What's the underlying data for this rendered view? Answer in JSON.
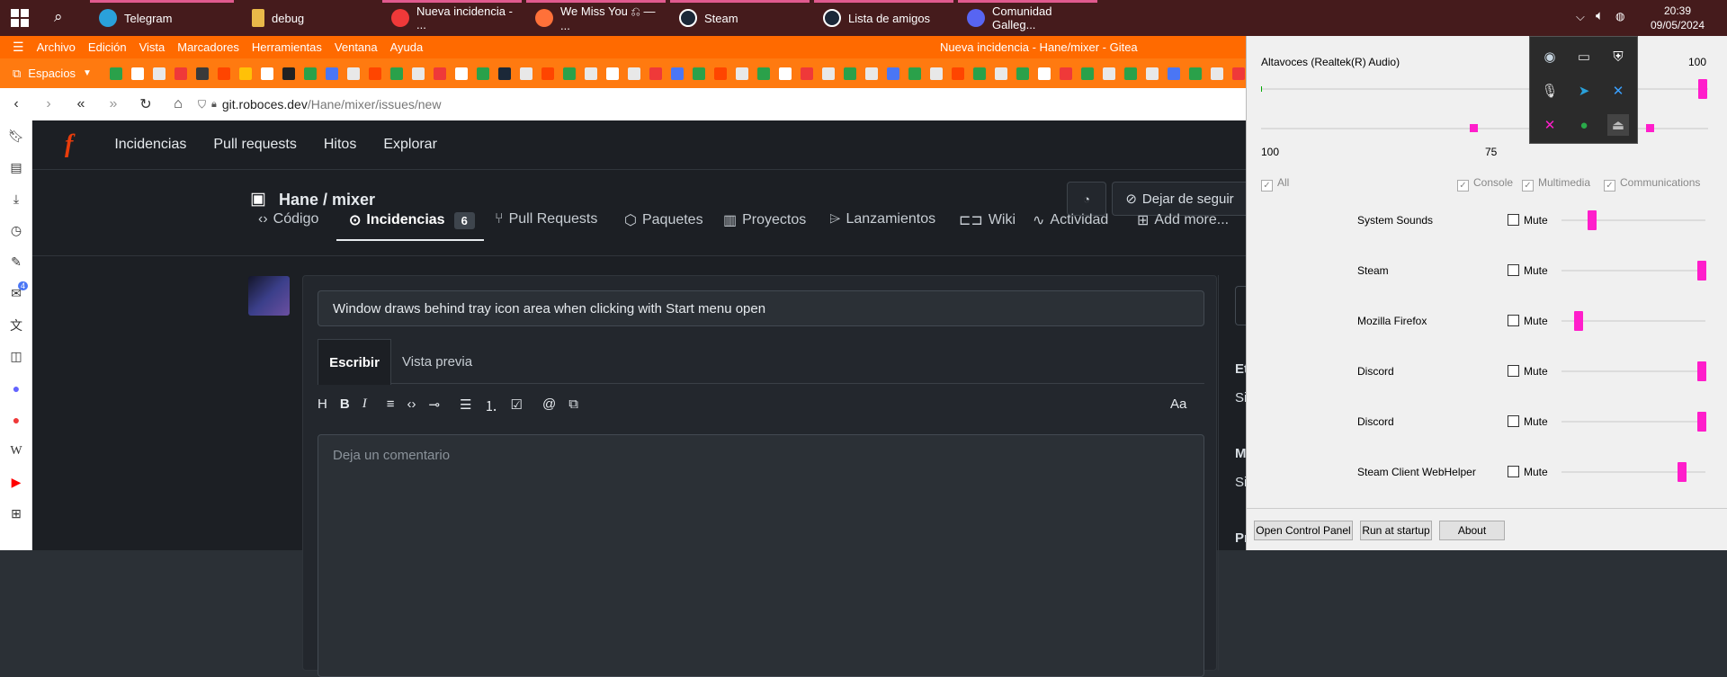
{
  "taskbar": {
    "apps": [
      {
        "label": "Telegram",
        "icon": "telegram-icon",
        "color": "#2aa1da"
      },
      {
        "label": "debug",
        "icon": "folder-icon",
        "color": "#e9b949"
      },
      {
        "label": "Nueva incidencia - ...",
        "icon": "vivaldi-icon",
        "color": "#ef3939"
      },
      {
        "label": "We Miss You ⎌ — ...",
        "icon": "firefox-icon",
        "color": "#ff7139"
      },
      {
        "label": "Steam",
        "icon": "steam-icon",
        "color": "#1b2838"
      },
      {
        "label": "Lista de amigos",
        "icon": "steam-icon",
        "color": "#1b2838"
      },
      {
        "label": "Comunidad Galleg...",
        "icon": "discord-icon",
        "color": "#5865f2"
      }
    ],
    "clock_time": "20:39",
    "clock_date": "09/05/2024"
  },
  "browser": {
    "menu": [
      "Archivo",
      "Edición",
      "Vista",
      "Marcadores",
      "Herramientas",
      "Ventana",
      "Ayuda"
    ],
    "window_title": "Nueva incidencia - Hane/mixer - Gitea",
    "workspaces_label": "Espacios",
    "url_host": "git.roboces.dev",
    "url_path": "/Hane/mixer/issues/new",
    "sidebar_badge": "4"
  },
  "gitea": {
    "nav": [
      "Incidencias",
      "Pull requests",
      "Hitos",
      "Explorar"
    ],
    "repo_title": "Hane / mixer",
    "unwatch_label": "Dejar de seguir",
    "tabs": [
      {
        "label": "Código",
        "icon": "code-icon"
      },
      {
        "label": "Incidencias",
        "icon": "issue-icon",
        "count": "6"
      },
      {
        "label": "Pull Requests",
        "icon": "pull-request-icon"
      },
      {
        "label": "Paquetes",
        "icon": "package-icon"
      },
      {
        "label": "Proyectos",
        "icon": "project-icon"
      },
      {
        "label": "Lanzamientos",
        "icon": "tag-icon"
      },
      {
        "label": "Wiki",
        "icon": "book-icon"
      },
      {
        "label": "Actividad",
        "icon": "pulse-icon"
      },
      {
        "label": "Add more...",
        "icon": "plus-square-icon"
      }
    ],
    "issue_title": "Window draws behind tray icon area when clicking with Start menu open",
    "write_tab": "Escribir",
    "preview_tab": "Vista previa",
    "comment_placeholder": "Deja un comentario",
    "font_toggle": "Aa",
    "side_labels": [
      "Et",
      "Si",
      "M",
      "Si",
      "Pr"
    ]
  },
  "mixer": {
    "device": "Altavoces (Realtek(R) Audio)",
    "device_value": "100",
    "balance_left": "100",
    "balance_right": "75",
    "master_level": 1.0,
    "filters": [
      {
        "label": "All",
        "checked": true
      },
      {
        "label": "Console",
        "checked": true
      },
      {
        "label": "Multimedia",
        "checked": true
      },
      {
        "label": "Communications",
        "checked": true
      }
    ],
    "mute_label": "Mute",
    "apps": [
      {
        "name": "System Sounds",
        "level": 0.22
      },
      {
        "name": "Steam",
        "level": 1.0
      },
      {
        "name": "Mozilla Firefox",
        "level": 0.12
      },
      {
        "name": "Discord",
        "level": 1.0
      },
      {
        "name": "Discord",
        "level": 1.0
      },
      {
        "name": "Steam Client WebHelper",
        "level": 0.86
      }
    ],
    "buttons": [
      "Open Control Panel",
      "Run at startup",
      "About"
    ]
  },
  "colors": {
    "taskbar": "#451b1c",
    "browser_accent": "#ff6a00",
    "slider_thumb": "#ff1ecb",
    "gitea_bg": "#1c1f24"
  }
}
